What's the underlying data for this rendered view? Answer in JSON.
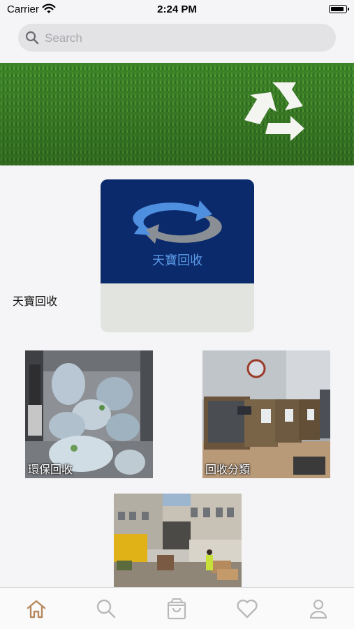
{
  "status_bar": {
    "carrier": "Carrier",
    "time": "2:24 PM",
    "battery_level": 0.9
  },
  "search": {
    "placeholder": "Search",
    "value": ""
  },
  "banner": {
    "image": "grass with recycle symbol"
  },
  "featured": {
    "image_text": "天寶回收",
    "caption": "天寶回收"
  },
  "tiles": [
    {
      "label": "環保回收",
      "image": "recycling bags in truck"
    },
    {
      "label": "回收分類",
      "image": "recycling sorting bins"
    },
    {
      "label": "",
      "image": "building courtyard with boxes and workers"
    }
  ],
  "tab_bar": {
    "items": [
      {
        "icon": "home-icon",
        "active": true
      },
      {
        "icon": "search-icon",
        "active": false
      },
      {
        "icon": "bag-icon",
        "active": false
      },
      {
        "icon": "heart-icon",
        "active": false
      },
      {
        "icon": "person-icon",
        "active": false
      }
    ],
    "active_color": "#b5895d",
    "inactive_color": "#b9b9b9"
  },
  "colors": {
    "accent": "#b5895d",
    "feature_bg": "#0b2a6b",
    "card_bg": "#e1e4df"
  }
}
